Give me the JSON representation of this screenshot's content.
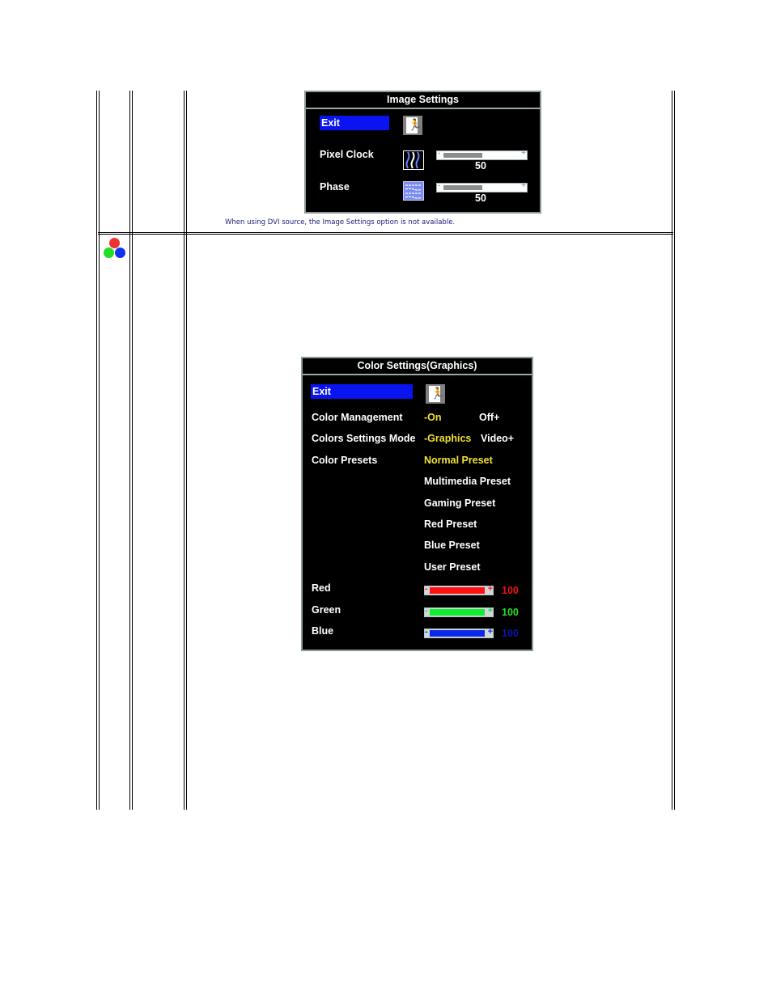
{
  "image_settings": {
    "title": "Image Settings",
    "exit_label": "Exit",
    "exit_icon": "exit-door-icon",
    "items": [
      {
        "label": "Pixel Clock",
        "icon": "pixel-clock-icon",
        "value": "50",
        "level_percent": 50
      },
      {
        "label": "Phase",
        "icon": "phase-icon",
        "value": "50",
        "level_percent": 50
      }
    ],
    "slider_minus": "-",
    "slider_plus": "+"
  },
  "note": "When using  DVI source, the Image Settings option is not available.",
  "row_icon": "color-settings-rgb-icon",
  "color_settings": {
    "title": "Color Settings(Graphics)",
    "exit_label": "Exit",
    "exit_icon": "exit-door-icon",
    "color_management": {
      "label": "Color Management",
      "selected": "-On",
      "other": "Off+"
    },
    "colors_settings_mode": {
      "label": "Colors Settings Mode",
      "selected": "-Graphics",
      "other": "Video+"
    },
    "color_presets": {
      "label": "Color Presets",
      "options": [
        "Normal Preset",
        "Multimedia Preset",
        "Gaming Preset",
        "Red Preset",
        "Blue Preset",
        "User Preset"
      ],
      "selected": "Normal Preset"
    },
    "channels": [
      {
        "label": "Red",
        "value": "100",
        "level_percent": 100,
        "color": "#ff1010",
        "value_color": "#ee1111",
        "bar_mark_color": "#ff2020"
      },
      {
        "label": "Green",
        "value": "100",
        "level_percent": 100,
        "color": "#10ee30",
        "value_color": "#22dd22",
        "bar_mark_color": "#22dd44"
      },
      {
        "label": "Blue",
        "value": "100",
        "level_percent": 100,
        "color": "#0a28e8",
        "value_color": "#1010aa",
        "bar_mark_color": "#1030cc"
      }
    ],
    "slider_minus": "-",
    "slider_plus": "+",
    "highlight_color": "#f0e030"
  }
}
